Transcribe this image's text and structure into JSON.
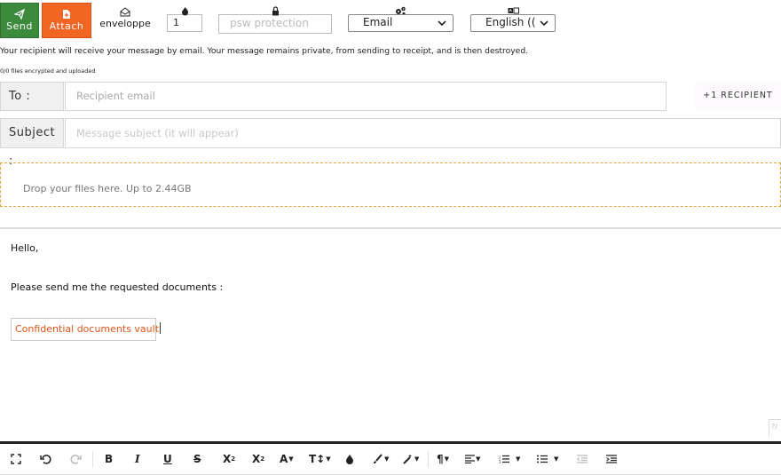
{
  "toolbar": {
    "send_label": "Send",
    "attach_label": "Attach",
    "envelope_label": "enveloppe",
    "count_value": "1",
    "password_placeholder": "psw protection",
    "delivery_method": "Email",
    "language": "English (("
  },
  "info_text": "Your recipient will receive your message by email. Your message remains private, from sending to receipt, and is then destroyed.",
  "upload_status": "0/0 files encrypted and uploaded",
  "to": {
    "label": "To :",
    "placeholder": "Recipient email"
  },
  "add_recipient_label": "+1 RECIPIENT",
  "subject": {
    "label": "Subject :",
    "placeholder": "Message subject (it will appear)"
  },
  "dropzone_text": "Drop your files here. Up to 2.44GB",
  "message": {
    "greeting": "Hello,",
    "line": "Please send me the requested documents :",
    "vault_link": "Confidential documents vault"
  },
  "colors": {
    "send_green": "#3c8a3c",
    "attach_orange": "#f26522",
    "link_orange": "#e0541c",
    "dropzone_border": "#e8a33d"
  },
  "editor_icons": [
    "fullscreen-icon",
    "undo-icon",
    "redo-icon",
    "bold-icon",
    "italic-icon",
    "underline-icon",
    "strikethrough-icon",
    "subscript-icon",
    "superscript-icon",
    "font-icon",
    "font-size-icon",
    "ink-icon",
    "brush-icon",
    "magic-icon",
    "paragraph-icon",
    "align-icon",
    "ordered-list-icon",
    "unordered-list-icon",
    "outdent-icon",
    "indent-icon"
  ]
}
